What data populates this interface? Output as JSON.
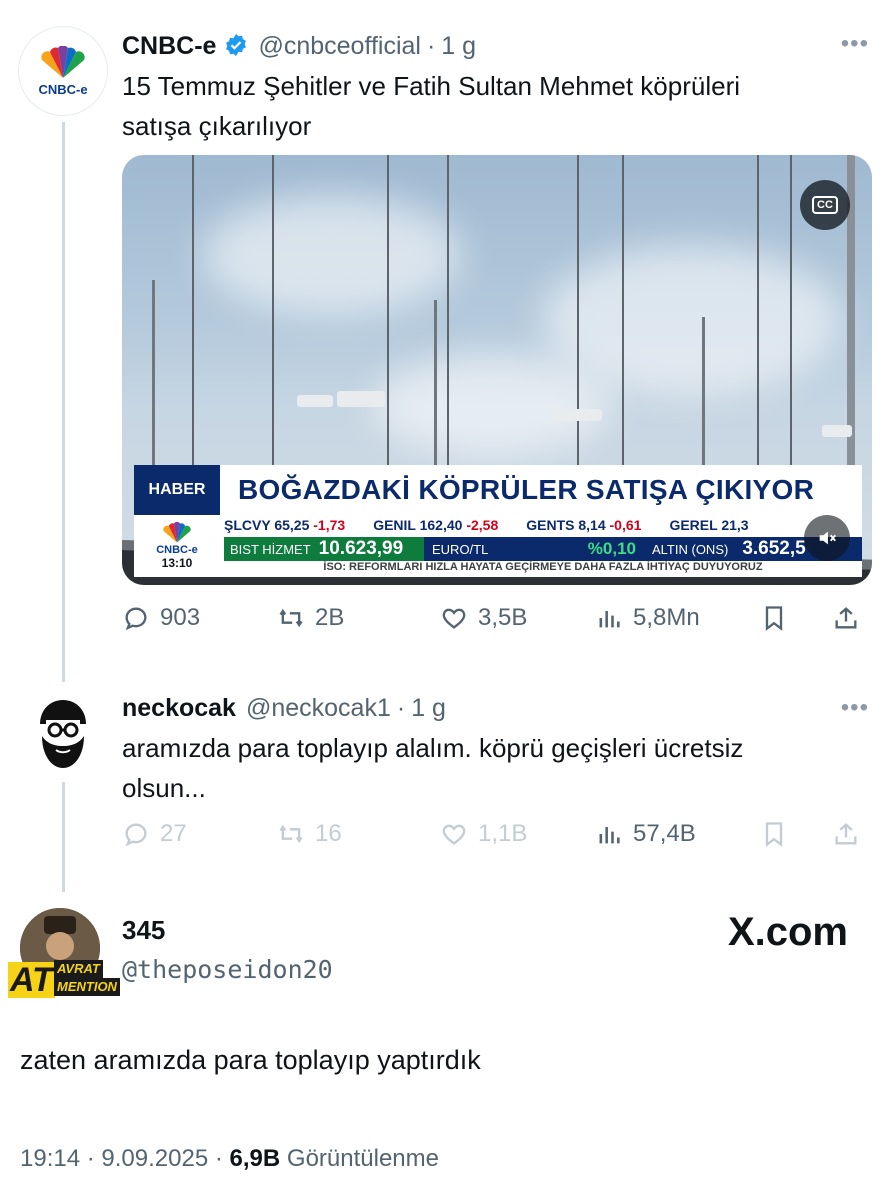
{
  "tweet1": {
    "name": "CNBC-e",
    "handle": "@cnbceofficial",
    "time": "1 g",
    "avatar_text": "CNBC-e",
    "text_line1": "15 Temmuz Şehitler ve Fatih Sultan Mehmet köprüleri",
    "text_line2": "satışa çıkarılıyor",
    "media": {
      "banner_tag": "HABER",
      "banner_title": "BOĞAZDAKİ KÖPRÜLER SATIŞA ÇIKIYOR",
      "logo": "CNBC-e",
      "clock": "13:10",
      "ticker": [
        {
          "code": "ŞLCVY",
          "value": "65,25",
          "change": "-1,73"
        },
        {
          "code": "GENIL",
          "value": "162,40",
          "change": "-2,58"
        },
        {
          "code": "GENTS",
          "value": "8,14",
          "change": "-0,61"
        },
        {
          "code": "GEREL",
          "value": "21,3",
          "change": ""
        }
      ],
      "bist_label": "BIST HİZMET",
      "bist_value": "10.623,99",
      "euro_label": "EURO/TL",
      "euro_value": "%0,10",
      "altin_label": "ALTIN (ONS)",
      "altin_value": "3.652,5",
      "crawl": "İSO: REFORMLARI HIZLA HAYATA GEÇİRMEYE DAHA FAZLA İHTİYAÇ DUYUYORUZ",
      "cc_label": "CC"
    },
    "replies": "903",
    "retweets": "2B",
    "likes": "3,5B",
    "views": "5,8Mn"
  },
  "tweet2": {
    "name": "neckocak",
    "handle": "@neckocak1",
    "time": "1 g",
    "text_line1": "aramızda para toplayıp alalım. köprü geçişleri ücretsiz",
    "text_line2": "olsun...",
    "replies": "27",
    "retweets": "16",
    "likes": "1,1B",
    "views": "57,4B"
  },
  "quote": {
    "name": "345",
    "handle": "@theposeidon20",
    "badge_big": "AT",
    "badge_small1": "AVRAT",
    "badge_small2": "MENTION",
    "watermark": "X.com",
    "text": "zaten aramızda para toplayıp yaptırdık",
    "footer_time": "19:14",
    "footer_date": "9.09.2025",
    "footer_views": "6,9B",
    "footer_views_label": "Görüntülenme"
  },
  "colors": {
    "verified": "#1d9bf0",
    "secondary_text": "#536471",
    "thread_line": "#cfd9de",
    "banner_blue": "#0b2a6b",
    "bist_green": "#0d7c3d"
  }
}
